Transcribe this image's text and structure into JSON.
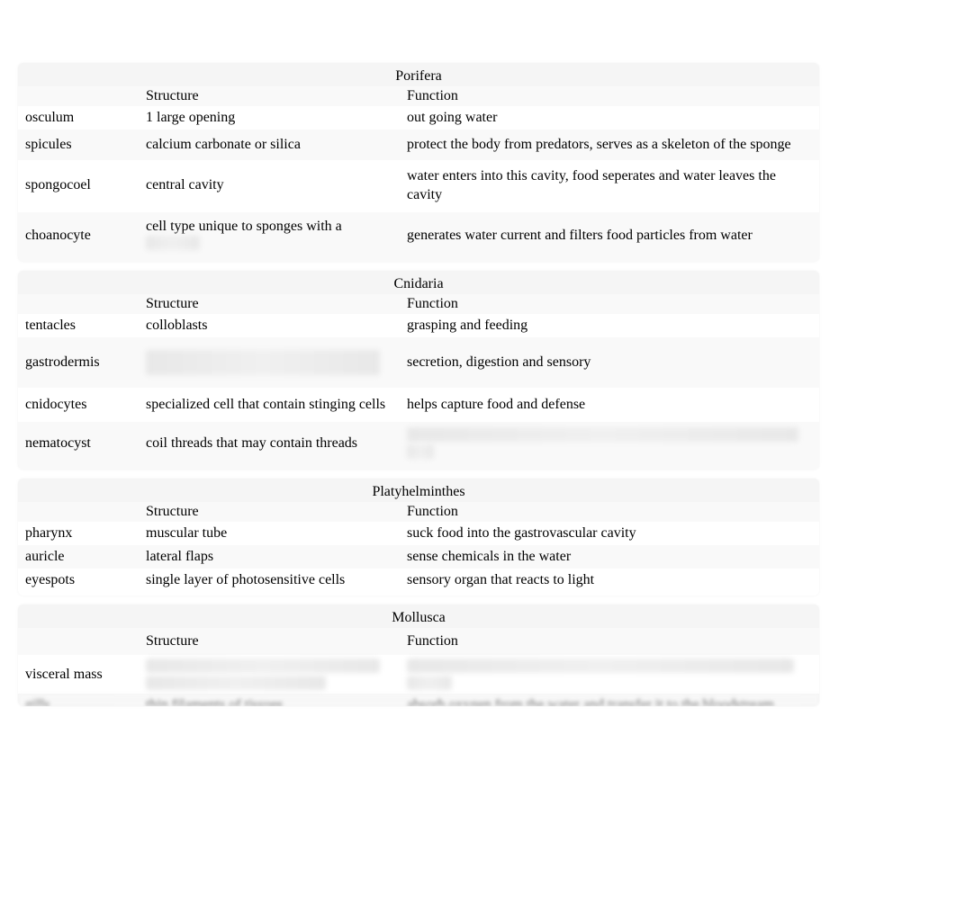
{
  "sections": [
    {
      "title": "Porifera",
      "headers": {
        "structure": "Structure",
        "function": "Function"
      },
      "rows": [
        {
          "name": "osculum",
          "structure": "1 large opening",
          "function": "out going water"
        },
        {
          "name": "spicules",
          "structure": "calcium carbonate or silica",
          "function": "protect the body from predators, serves as a skeleton of the sponge"
        },
        {
          "name": "spongocoel",
          "structure": "central cavity",
          "function": "water enters into this cavity, food seperates and water leaves the cavity"
        },
        {
          "name": "choanocyte",
          "structure": "cell type unique to sponges with a flagellum",
          "structureBlurred": "flagellum",
          "function": "generates water current and filters food particles from water"
        }
      ]
    },
    {
      "title": "Cnidaria",
      "headers": {
        "structure": "Structure",
        "function": "Function"
      },
      "rows": [
        {
          "name": "tentacles",
          "structure": "colloblasts",
          "function": "grasping and feeding"
        },
        {
          "name": "gastrodermis",
          "structure": "",
          "structureBlurredFull": true,
          "function": "secretion, digestion and sensory"
        },
        {
          "name": "cnidocytes",
          "structure": "specialized cell that contain stinging cells",
          "function": "helps capture food and defense"
        },
        {
          "name": "nematocyst",
          "structure": "coil threads that may contain threads",
          "function": "",
          "functionBlurredFull": true
        }
      ]
    },
    {
      "title": "Platyhelminthes",
      "headers": {
        "structure": "Structure",
        "function": "Function"
      },
      "rows": [
        {
          "name": "pharynx",
          "structure": "muscular tube",
          "function": "suck food into the gastrovascular cavity"
        },
        {
          "name": "auricle",
          "structure": "lateral flaps",
          "function": "sense chemicals in the water"
        },
        {
          "name": "eyespots",
          "structure": "single layer of photosensitive cells",
          "function": "sensory organ that reacts to light"
        }
      ]
    },
    {
      "title": "Mollusca",
      "headers": {
        "structure": "Structure",
        "function": "Function"
      },
      "rows": [
        {
          "name": "visceral mass",
          "structure": "",
          "structureBlurredFull": true,
          "function": "",
          "functionBlurredFull": true
        },
        {
          "name": "gills",
          "structure": "thin filaments of tissues",
          "function": "absorb oxygen from the water and transfer it to the bloodstream",
          "rowBlurred": true
        }
      ]
    }
  ]
}
